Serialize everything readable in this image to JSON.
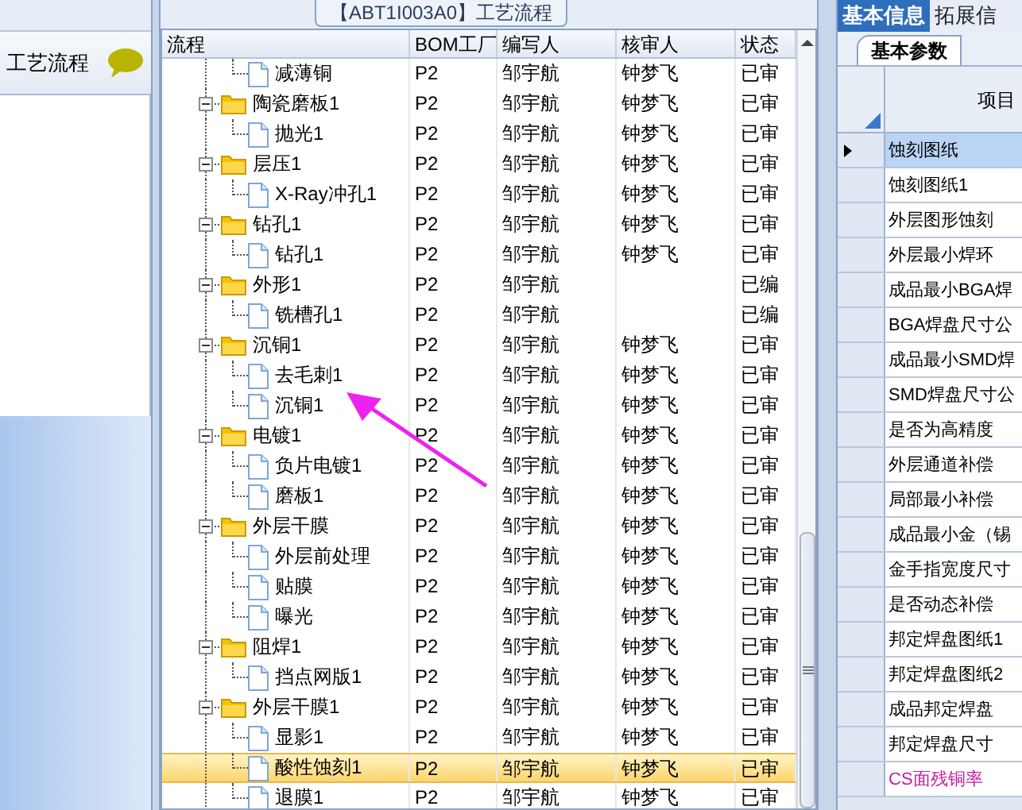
{
  "title_tab": "【ABT1I003A0】工艺流程",
  "left_panel": {
    "title": "工艺流程"
  },
  "tree": {
    "columns": [
      "流程",
      "BOM工厂",
      "编写人",
      "核审人",
      "状态"
    ],
    "rows": [
      {
        "kind": "step",
        "name": "减薄铜",
        "bom": "P2",
        "author": "邹宇航",
        "reviewer": "钟梦飞",
        "status": "已审",
        "selected": false
      },
      {
        "kind": "group",
        "name": "陶瓷磨板1",
        "bom": "P2",
        "author": "邹宇航",
        "reviewer": "钟梦飞",
        "status": "已审",
        "expanded": true,
        "selected": false,
        "children": [
          {
            "kind": "step",
            "name": "抛光1",
            "bom": "P2",
            "author": "邹宇航",
            "reviewer": "钟梦飞",
            "status": "已审",
            "selected": false
          }
        ]
      },
      {
        "kind": "group",
        "name": "层压1",
        "bom": "P2",
        "author": "邹宇航",
        "reviewer": "钟梦飞",
        "status": "已审",
        "expanded": true,
        "selected": false,
        "children": [
          {
            "kind": "step",
            "name": "X-Ray冲孔1",
            "bom": "P2",
            "author": "邹宇航",
            "reviewer": "钟梦飞",
            "status": "已审",
            "selected": false
          }
        ]
      },
      {
        "kind": "group",
        "name": "钻孔1",
        "bom": "P2",
        "author": "邹宇航",
        "reviewer": "钟梦飞",
        "status": "已审",
        "expanded": true,
        "selected": false,
        "children": [
          {
            "kind": "step",
            "name": "钻孔1",
            "bom": "P2",
            "author": "邹宇航",
            "reviewer": "钟梦飞",
            "status": "已审",
            "selected": false
          }
        ]
      },
      {
        "kind": "group",
        "name": "外形1",
        "bom": "P2",
        "author": "邹宇航",
        "status": "已编",
        "expanded": true,
        "selected": false,
        "children": [
          {
            "kind": "step",
            "name": "铣槽孔1",
            "bom": "P2",
            "author": "邹宇航",
            "status": "已编",
            "selected": false
          }
        ]
      },
      {
        "kind": "group",
        "name": "沉铜1",
        "bom": "P2",
        "author": "邹宇航",
        "reviewer": "钟梦飞",
        "status": "已审",
        "expanded": true,
        "selected": false,
        "children": [
          {
            "kind": "step",
            "name": "去毛刺1",
            "bom": "P2",
            "author": "邹宇航",
            "reviewer": "钟梦飞",
            "status": "已审",
            "selected": false
          },
          {
            "kind": "step",
            "name": "沉铜1",
            "bom": "P2",
            "author": "邹宇航",
            "reviewer": "钟梦飞",
            "status": "已审",
            "selected": false
          }
        ]
      },
      {
        "kind": "group",
        "name": "电镀1",
        "bom": "P2",
        "author": "邹宇航",
        "reviewer": "钟梦飞",
        "status": "已审",
        "expanded": true,
        "selected": false,
        "children": [
          {
            "kind": "step",
            "name": "负片电镀1",
            "bom": "P2",
            "author": "邹宇航",
            "reviewer": "钟梦飞",
            "status": "已审",
            "selected": false
          },
          {
            "kind": "step",
            "name": "磨板1",
            "bom": "P2",
            "author": "邹宇航",
            "reviewer": "钟梦飞",
            "status": "已审",
            "selected": false
          }
        ]
      },
      {
        "kind": "group",
        "name": "外层干膜",
        "bom": "P2",
        "author": "邹宇航",
        "reviewer": "钟梦飞",
        "status": "已审",
        "expanded": true,
        "selected": false,
        "children": [
          {
            "kind": "step",
            "name": "外层前处理",
            "bom": "P2",
            "author": "邹宇航",
            "reviewer": "钟梦飞",
            "status": "已审",
            "selected": false
          },
          {
            "kind": "step",
            "name": "贴膜",
            "bom": "P2",
            "author": "邹宇航",
            "reviewer": "钟梦飞",
            "status": "已审",
            "selected": false
          },
          {
            "kind": "step",
            "name": "曝光",
            "bom": "P2",
            "author": "邹宇航",
            "reviewer": "钟梦飞",
            "status": "已审",
            "selected": false
          }
        ]
      },
      {
        "kind": "group",
        "name": "阻焊1",
        "bom": "P2",
        "author": "邹宇航",
        "reviewer": "钟梦飞",
        "status": "已审",
        "expanded": true,
        "selected": false,
        "children": [
          {
            "kind": "step",
            "name": "挡点网版1",
            "bom": "P2",
            "author": "邹宇航",
            "reviewer": "钟梦飞",
            "status": "已审",
            "selected": false
          }
        ]
      },
      {
        "kind": "group",
        "name": "外层干膜1",
        "bom": "P2",
        "author": "邹宇航",
        "reviewer": "钟梦飞",
        "status": "已审",
        "expanded": true,
        "selected": false,
        "children": [
          {
            "kind": "step",
            "name": "显影1",
            "bom": "P2",
            "author": "邹宇航",
            "reviewer": "钟梦飞",
            "status": "已审",
            "selected": false
          },
          {
            "kind": "step",
            "name": "酸性蚀刻1",
            "bom": "P2",
            "author": "邹宇航",
            "reviewer": "钟梦飞",
            "status": "已审",
            "selected": true
          },
          {
            "kind": "step",
            "name": "退膜1",
            "bom": "P2",
            "author": "邹宇航",
            "reviewer": "钟梦飞",
            "status": "已审",
            "selected": false
          }
        ]
      }
    ]
  },
  "right_panel": {
    "tabs": [
      {
        "label": "基本信息",
        "selected": true
      },
      {
        "label": "拓展信",
        "selected": false
      }
    ],
    "subtabs": [
      {
        "label": "基本参数",
        "selected": true
      }
    ],
    "grid": {
      "column": "项目",
      "rows": [
        {
          "label": "蚀刻图纸",
          "selected": true,
          "color": "#000000"
        },
        {
          "label": "蚀刻图纸1",
          "selected": false,
          "color": "#000000"
        },
        {
          "label": "外层图形蚀刻",
          "selected": false,
          "color": "#000000"
        },
        {
          "label": "外层最小焊环",
          "selected": false,
          "color": "#000000"
        },
        {
          "label": "成品最小BGA焊",
          "selected": false,
          "color": "#000000"
        },
        {
          "label": "BGA焊盘尺寸公",
          "selected": false,
          "color": "#000000"
        },
        {
          "label": "成品最小SMD焊",
          "selected": false,
          "color": "#000000"
        },
        {
          "label": "SMD焊盘尺寸公",
          "selected": false,
          "color": "#000000"
        },
        {
          "label": "是否为高精度",
          "selected": false,
          "color": "#000000"
        },
        {
          "label": "外层通道补偿",
          "selected": false,
          "color": "#000000"
        },
        {
          "label": "局部最小补偿",
          "selected": false,
          "color": "#000000"
        },
        {
          "label": "成品最小金（锡",
          "selected": false,
          "color": "#000000"
        },
        {
          "label": "金手指宽度尺寸",
          "selected": false,
          "color": "#000000"
        },
        {
          "label": "是否动态补偿",
          "selected": false,
          "color": "#000000"
        },
        {
          "label": "邦定焊盘图纸1",
          "selected": false,
          "color": "#000000"
        },
        {
          "label": "邦定焊盘图纸2",
          "selected": false,
          "color": "#000000"
        },
        {
          "label": "成品邦定焊盘",
          "selected": false,
          "color": "#000000"
        },
        {
          "label": "邦定焊盘尺寸",
          "selected": false,
          "color": "#000000"
        },
        {
          "label": "CS面残铜率",
          "selected": false,
          "color": "#c0209c"
        }
      ]
    }
  }
}
